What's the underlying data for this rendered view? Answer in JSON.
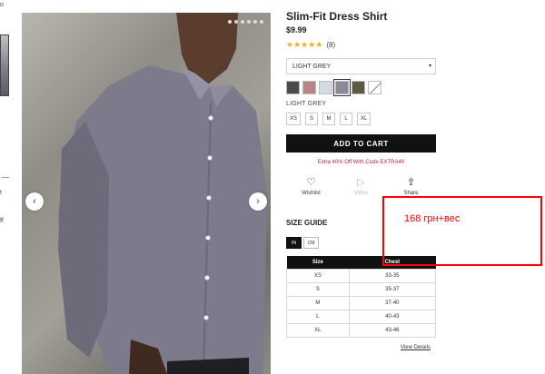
{
  "left_strip": {
    "fragments": [
      "о",
      "t",
      "ff"
    ]
  },
  "image": {
    "slide_count": 6,
    "active_slide": 1,
    "prev_icon": "chevron-left-icon",
    "next_icon": "chevron-right-icon",
    "prev_glyph": "‹",
    "next_glyph": "›"
  },
  "product": {
    "title": "Slim-Fit Dress Shirt",
    "price": "$9.99",
    "stars": "★★★★★",
    "rating_count": "(8)",
    "rating_value": 4.5
  },
  "color_select": {
    "value": "LIGHT GREY",
    "caret": "▾"
  },
  "swatches": [
    {
      "color": "#4a4c49",
      "name": "charcoal"
    },
    {
      "color": "#b78587",
      "name": "rose"
    },
    {
      "color": "#d2dbe4",
      "name": "light blue"
    },
    {
      "color": "#8c8a98",
      "name": "light grey",
      "selected": true
    },
    {
      "color": "#5d5a43",
      "name": "olive"
    },
    {
      "color": "#ffffff",
      "name": "white"
    }
  ],
  "selected_color_label": "LIGHT GREY",
  "sizes": [
    "XS",
    "S",
    "M",
    "L",
    "XL"
  ],
  "add_to_cart": "ADD TO CART",
  "promo": "Extra 40% Off With Code EXTRA40",
  "actions": [
    {
      "icon": "heart-icon",
      "glyph": "♡",
      "label": "Wishlist",
      "disabled": false
    },
    {
      "icon": "play-icon",
      "glyph": "▷",
      "label": "Video",
      "disabled": true
    },
    {
      "icon": "share-icon",
      "glyph": "⇪",
      "label": "Share",
      "disabled": false
    }
  ],
  "size_guide": {
    "title": "SIZE GUIDE",
    "units": [
      {
        "label": "IN",
        "active": true
      },
      {
        "label": "CM",
        "active": false
      }
    ],
    "headers": [
      "Size",
      "Chest"
    ],
    "rows": [
      [
        "XS",
        "33-35"
      ],
      [
        "S",
        "35-37"
      ],
      [
        "M",
        "37-40"
      ],
      [
        "L",
        "40-43"
      ],
      [
        "XL",
        "43-46"
      ]
    ],
    "view_details": "View Details"
  },
  "annotation": {
    "text": "168 грн+вес",
    "color": "#ff0000"
  }
}
